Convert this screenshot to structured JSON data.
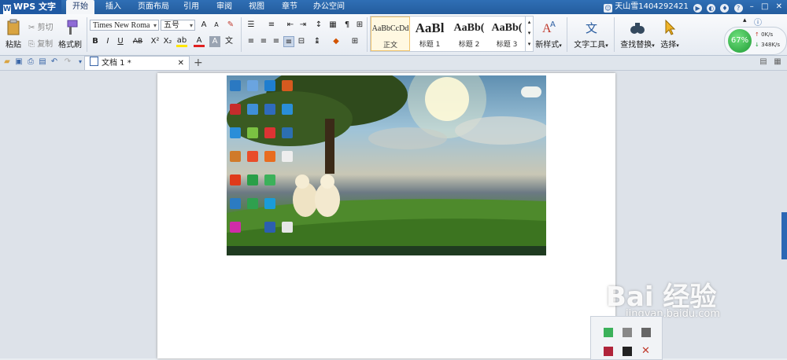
{
  "app": {
    "name": "WPS 文字"
  },
  "menu": {
    "tabs": [
      "开始",
      "插入",
      "页面布局",
      "引用",
      "审阅",
      "视图",
      "章节",
      "办公空间"
    ]
  },
  "user": {
    "name": "天山雪1404292421"
  },
  "ribbon": {
    "paste": "粘贴",
    "cut": "剪切",
    "copy": "复制",
    "format_painter": "格式刷",
    "font_name": "Times New Roma",
    "font_size": "五号",
    "styles": [
      {
        "preview": "AaBbCcDd",
        "label": "正文"
      },
      {
        "preview": "AaBl",
        "label": "标题 1"
      },
      {
        "preview": "AaBb(",
        "label": "标题 2"
      },
      {
        "preview": "AaBb(",
        "label": "标题 3"
      }
    ],
    "new_style": "新样式",
    "text_tools": "文字工具",
    "find_replace": "查找替换",
    "select": "选择"
  },
  "perf": {
    "percent": "67%",
    "up": "0K/s",
    "down": "348K/s"
  },
  "document": {
    "tab_title": "文档 1 *"
  },
  "watermark": {
    "logo": "Bai 经验",
    "url": "jingyan.baidu.com"
  },
  "colors": {
    "menubar": "#2b66ac",
    "accent": "#1f9b35"
  }
}
